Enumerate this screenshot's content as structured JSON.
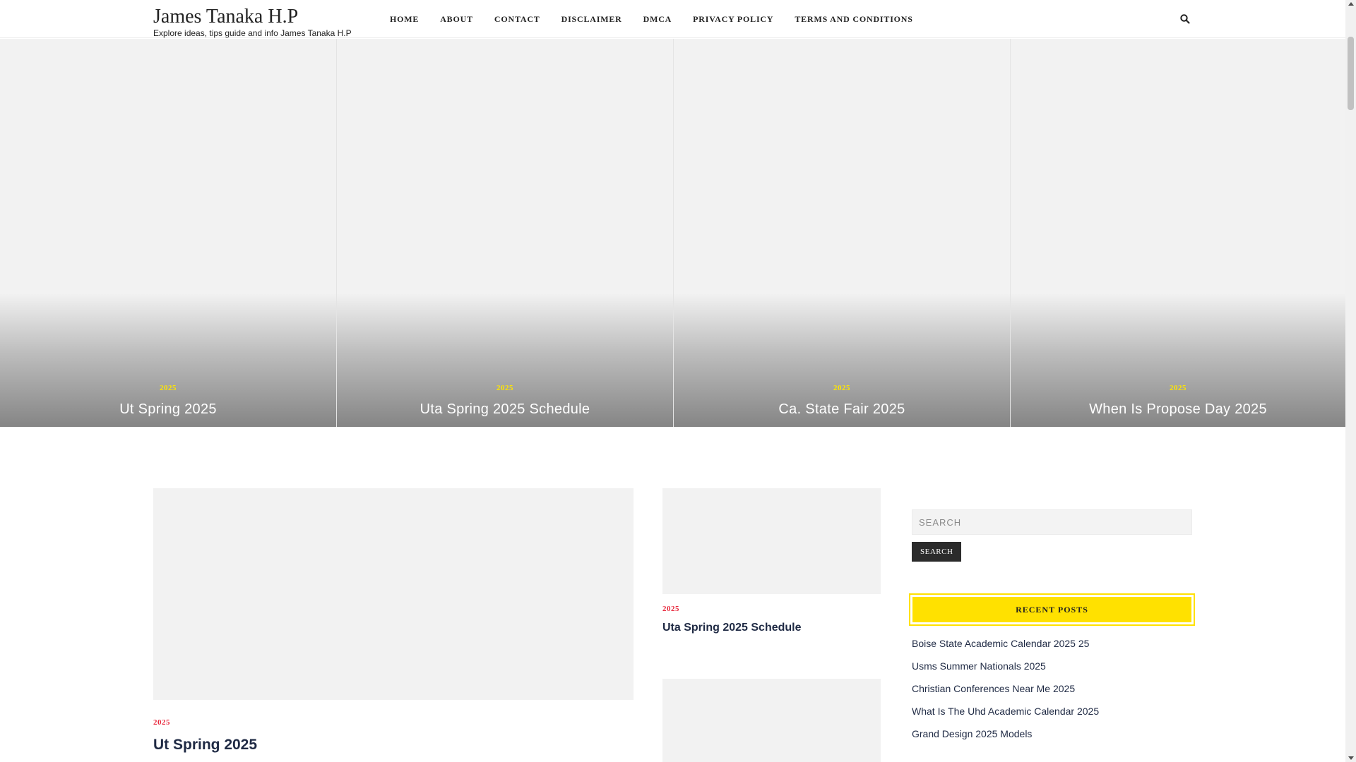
{
  "site": {
    "title": "James Tanaka H.P",
    "tagline": "Explore ideas, tips guide and info James Tanaka H.P"
  },
  "nav": {
    "items": [
      "HOME",
      "ABOUT",
      "CONTACT",
      "DISCLAIMER",
      "DMCA",
      "PRIVACY POLICY",
      "TERMS AND CONDITIONS"
    ]
  },
  "icons": {
    "search": "search-icon"
  },
  "featured": [
    {
      "category": "2025",
      "title": "Ut Spring 2025"
    },
    {
      "category": "2025",
      "title": "Uta Spring 2025 Schedule"
    },
    {
      "category": "2025",
      "title": "Ca. State Fair 2025"
    },
    {
      "category": "2025",
      "title": "When Is Propose Day 2025"
    }
  ],
  "posts": {
    "main": {
      "category": "2025",
      "title": "Ut Spring 2025"
    },
    "side": {
      "category": "2025",
      "title": "Uta Spring 2025 Schedule"
    }
  },
  "sidebar": {
    "search_placeholder": "SEARCH",
    "search_button": "SEARCH",
    "recent_title": "RECENT POSTS",
    "recent_posts": [
      "Boise State Academic Calendar 2025 25",
      "Usms Summer Nationals 2025",
      "Christian Conferences Near Me 2025",
      "What Is The Uhd Academic Calendar 2025",
      "Grand Design 2025 Models"
    ]
  },
  "colors": {
    "accent_yellow": "#ffe100",
    "category_red": "#e8293d",
    "title_navy": "#1f2a44"
  }
}
